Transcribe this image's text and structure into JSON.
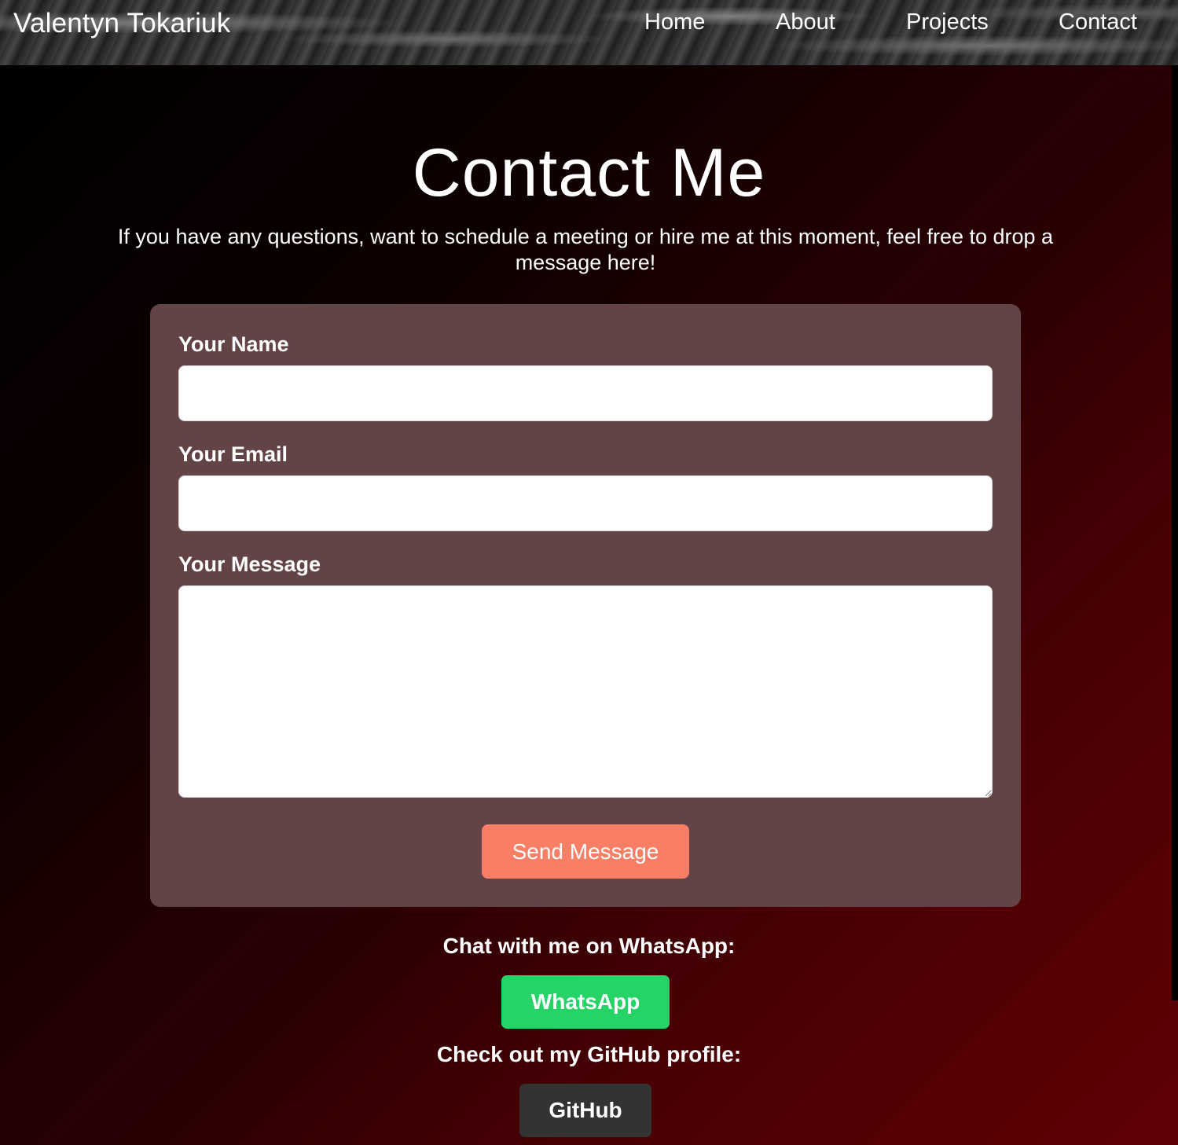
{
  "header": {
    "brand": "Valentyn Tokariuk",
    "nav": [
      {
        "label": "Home"
      },
      {
        "label": "About"
      },
      {
        "label": "Projects"
      },
      {
        "label": "Contact"
      }
    ]
  },
  "main": {
    "title": "Contact Me",
    "intro": "If you have any questions, want to schedule a meeting or hire me at this moment, feel free to drop a message here!"
  },
  "form": {
    "name_label": "Your Name",
    "name_value": "",
    "email_label": "Your Email",
    "email_value": "",
    "message_label": "Your Message",
    "message_value": "",
    "submit_label": "Send Message"
  },
  "social": {
    "whatsapp_prompt": "Chat with me on WhatsApp:",
    "whatsapp_label": "WhatsApp",
    "github_prompt": "Check out my GitHub profile:",
    "github_label": "GitHub"
  },
  "colors": {
    "card_background": "#634446",
    "submit_button": "#f87f66",
    "whatsapp_button": "#25d366",
    "github_button": "#333333"
  }
}
